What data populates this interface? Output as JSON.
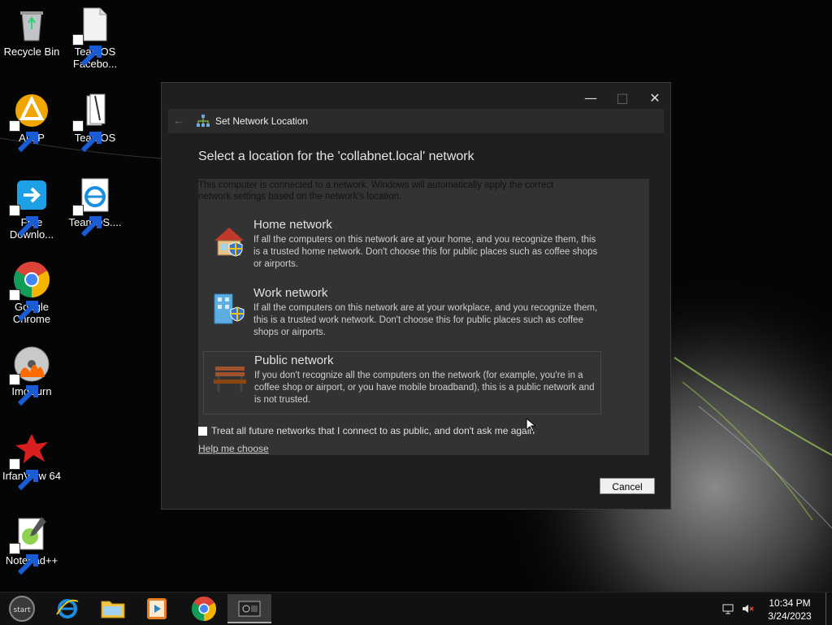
{
  "desktop": {
    "icons": [
      {
        "label": "Recycle Bin"
      },
      {
        "label": "TeamOS Facebo..."
      },
      {
        "label": "AIMP"
      },
      {
        "label": "TeamOS"
      },
      {
        "label": "Free Downlo..."
      },
      {
        "label": "TeamOS...."
      },
      {
        "label": "Google Chrome"
      },
      {
        "label": "ImgBurn"
      },
      {
        "label": "IrfanView 64"
      },
      {
        "label": "Notepad++"
      }
    ]
  },
  "dialog": {
    "title": "Set Network Location",
    "heading": "Select a location for the 'collabnet.local' network",
    "intro": "This computer is connected to a network. Windows will automatically apply the correct network settings based on the network's location.",
    "options": [
      {
        "title": "Home network",
        "description": "If all the computers on this network are at your home, and you recognize them, this is a trusted home network.  Don't choose this for public places such as coffee shops or airports."
      },
      {
        "title": "Work network",
        "description": "If all the computers on this network are at your workplace, and you recognize them, this is a trusted work network.  Don't choose this for public places such as coffee shops or airports."
      },
      {
        "title": "Public network",
        "description": "If you don't recognize all the computers on the network (for example, you're in a coffee shop or airport, or you have mobile broadband), this is a public network and is not trusted."
      }
    ],
    "checkbox_label": "Treat all future networks that I connect to as public, and don't ask me again",
    "help_link": "Help me choose",
    "cancel_label": "Cancel"
  },
  "taskbar": {
    "start_label": "start",
    "clock_time": "10:34 PM",
    "clock_date": "3/24/2023"
  }
}
